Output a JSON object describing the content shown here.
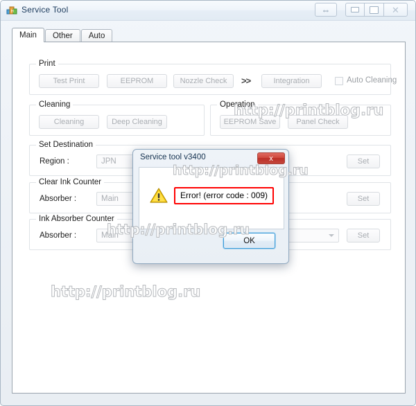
{
  "window": {
    "title": "Service Tool",
    "icon": "app-blocks-icon",
    "controls": {
      "resize": "⇔",
      "minimize": "minimize",
      "maximize": "maximize",
      "close": "✕"
    }
  },
  "tabs": [
    {
      "label": "Main",
      "active": true
    },
    {
      "label": "Other",
      "active": false
    },
    {
      "label": "Auto",
      "active": false
    }
  ],
  "groups": {
    "print": {
      "legend": "Print",
      "buttons": [
        "Test Print",
        "EEPROM",
        "Nozzle Check",
        "Integration"
      ],
      "separator": ">>",
      "checkbox_label": "Auto Cleaning",
      "checkbox_checked": false
    },
    "cleaning": {
      "legend": "Cleaning",
      "buttons": [
        "Cleaning",
        "Deep Cleaning"
      ]
    },
    "operation": {
      "legend": "Operation",
      "buttons": [
        "EEPROM Save",
        "Panel Check"
      ]
    },
    "set_destination": {
      "legend": "Set Destination",
      "field_label": "Region :",
      "field_value": "JPN",
      "set_label": "Set"
    },
    "clear_ink_counter": {
      "legend": "Clear Ink Counter",
      "field_label": "Absorber :",
      "field_value": "Main",
      "set_label": "Set"
    },
    "ink_absorber_counter": {
      "legend": "Ink Absorber Counter",
      "field_label": "Absorber :",
      "field_value": "Main",
      "counter_value": "",
      "set_label": "Set"
    }
  },
  "dialog": {
    "title": "Service tool v3400",
    "close_label": "x",
    "icon": "warning-triangle-icon",
    "message": "Error! (error code : 009)",
    "ok_label": "OK",
    "error_border_color": "#ff0000"
  },
  "watermarks": {
    "w1": "http://printblog.ru",
    "w2": "http://printblog.ru",
    "w3": "http://printblog.ru",
    "w4": "http://printblog.ru"
  }
}
